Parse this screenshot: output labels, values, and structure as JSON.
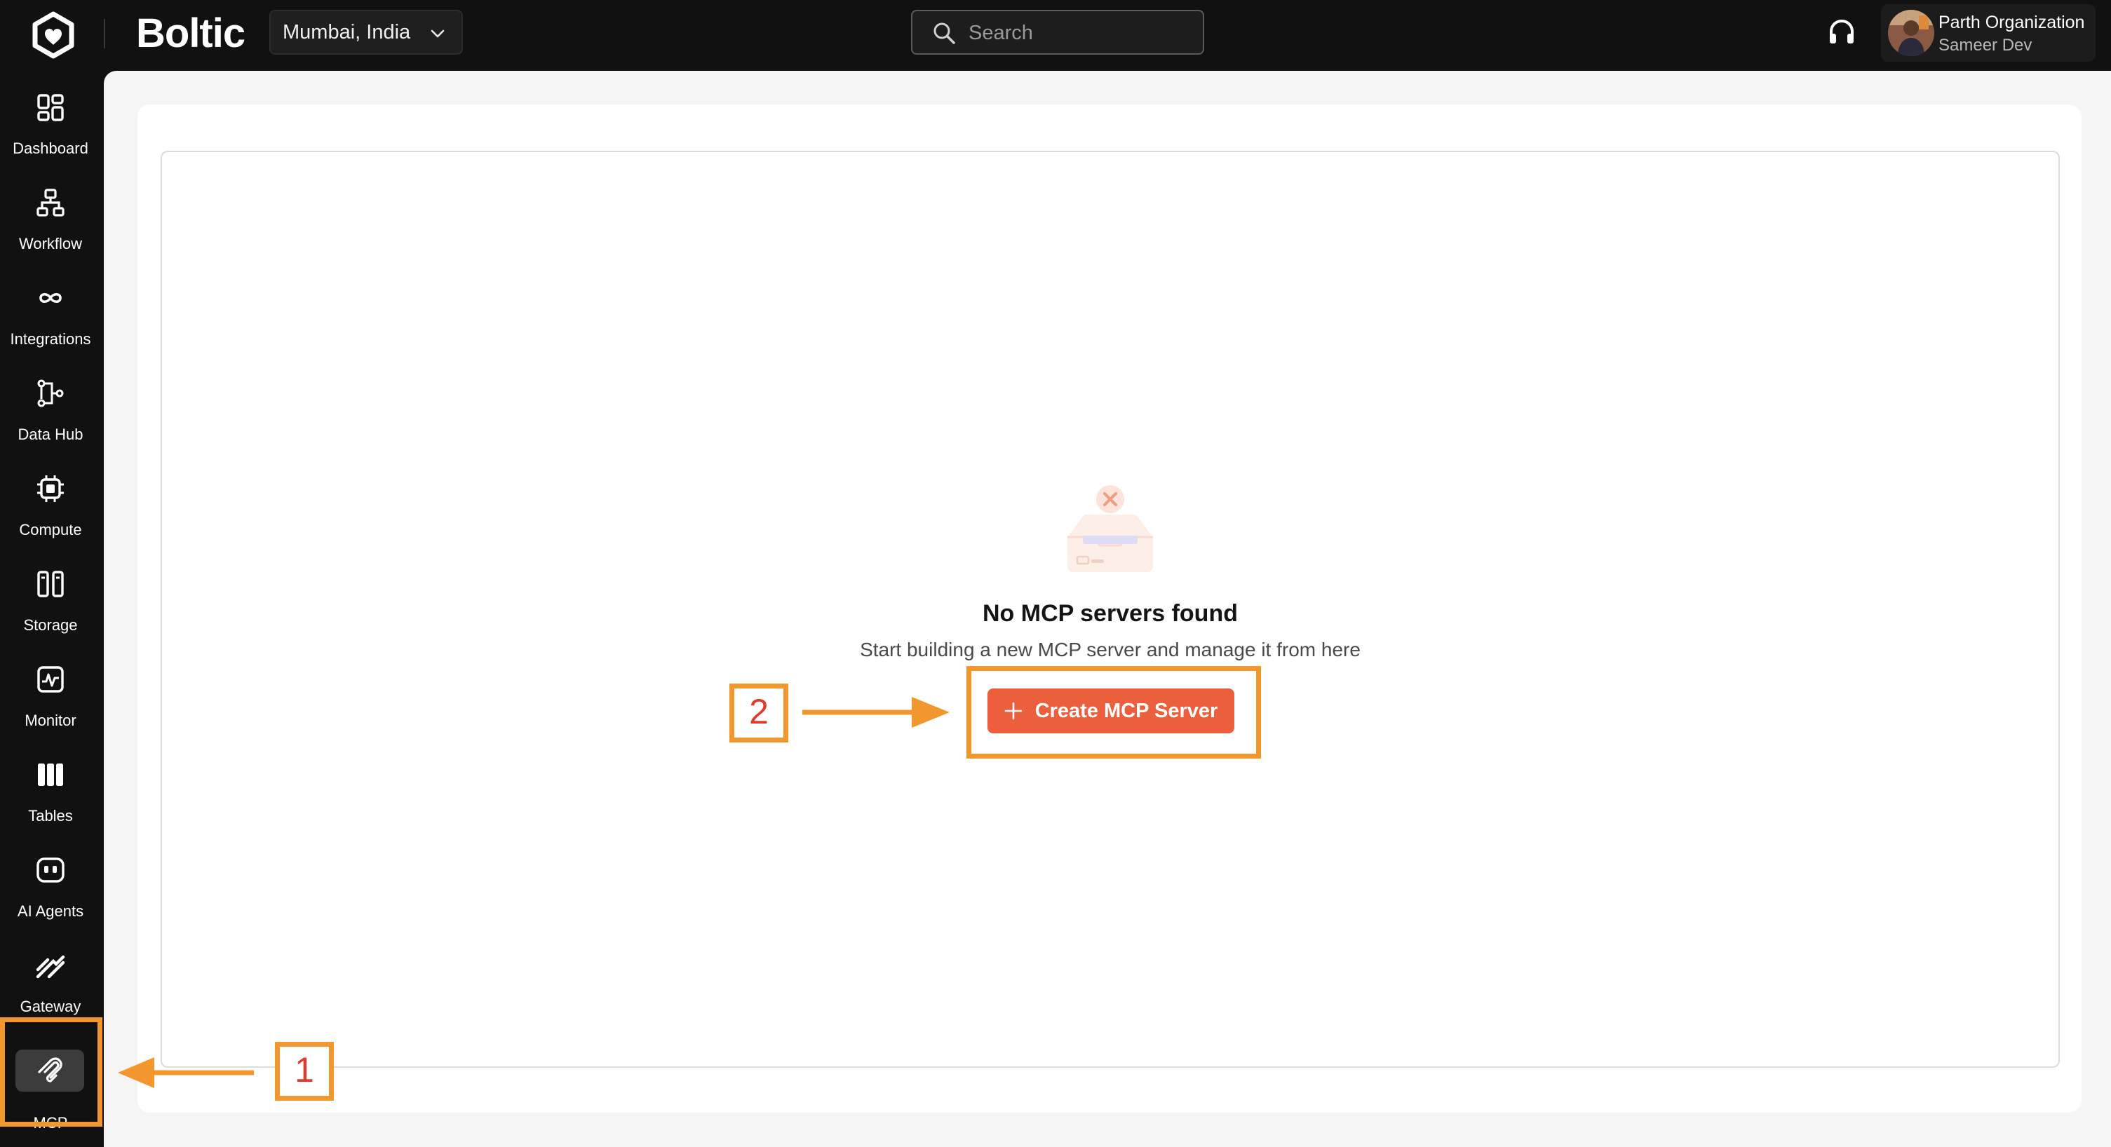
{
  "topbar": {
    "brand": "Boltic",
    "region": "Mumbai, India",
    "search_placeholder": "Search",
    "account": {
      "organization": "Parth Organization",
      "user": "Sameer Dev"
    }
  },
  "sidebar": {
    "items": [
      {
        "label": "Dashboard",
        "icon": "dashboard-icon"
      },
      {
        "label": "Workflow",
        "icon": "workflow-icon"
      },
      {
        "label": "Integrations",
        "icon": "integrations-icon"
      },
      {
        "label": "Data Hub",
        "icon": "data-hub-icon"
      },
      {
        "label": "Compute",
        "icon": "compute-icon"
      },
      {
        "label": "Storage",
        "icon": "storage-icon"
      },
      {
        "label": "Monitor",
        "icon": "monitor-icon"
      },
      {
        "label": "Tables",
        "icon": "tables-icon"
      },
      {
        "label": "AI Agents",
        "icon": "ai-agents-icon"
      },
      {
        "label": "Gateway",
        "icon": "gateway-icon"
      },
      {
        "label": "MCP",
        "icon": "mcp-icon",
        "active": true
      }
    ]
  },
  "main": {
    "empty_title": "No MCP servers found",
    "empty_subtitle": "Start building a new MCP server and manage it from here",
    "create_button": "Create MCP Server"
  },
  "annotations": {
    "step1": "1",
    "step2": "2",
    "color": "#f2962e",
    "number_color": "#e03c2c"
  },
  "colors": {
    "accent": "#ec5f3c",
    "sidebar_bg": "#111111",
    "content_bg": "#f5f5f5"
  }
}
